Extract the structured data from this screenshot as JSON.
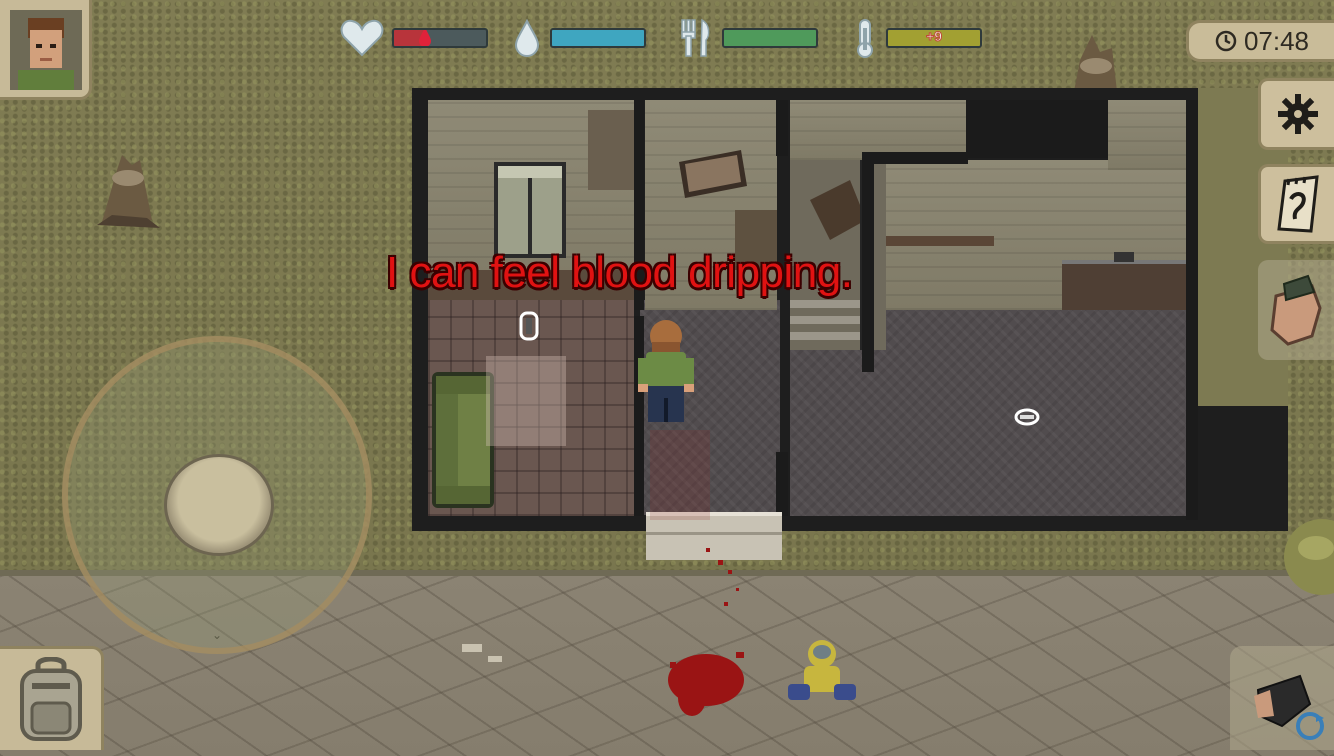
{
  "hud": {
    "health": {
      "icon": "heart-icon",
      "value": 0.35,
      "color": "#b8343b",
      "bleeding_icon": "blood-drop-icon"
    },
    "thirst": {
      "icon": "water-drop-icon",
      "value": 1.0,
      "color": "#3fa6c0"
    },
    "hunger": {
      "icon": "fork-knife-icon",
      "value": 1.0,
      "color": "#4f9a5b"
    },
    "temperature": {
      "icon": "thermometer-icon",
      "value": 1.0,
      "color": "#a2a032",
      "label": "+9"
    }
  },
  "clock": {
    "icon": "clock-icon",
    "time": "07:48"
  },
  "speech_text": "I can feel blood dripping.",
  "buttons": {
    "portrait": "character-portrait-icon",
    "settings": "gear-icon",
    "journal": "notebook-icon",
    "hand": "hand-attack-icon",
    "backpack": "backpack-icon",
    "swap_weapon": "swap-weapon-icon"
  },
  "colors": {
    "grass": "#7d7a52",
    "road": "#857d6d",
    "wall": "#1b1b1b",
    "panel": "#cdbf9d",
    "speech": "#e01212"
  }
}
